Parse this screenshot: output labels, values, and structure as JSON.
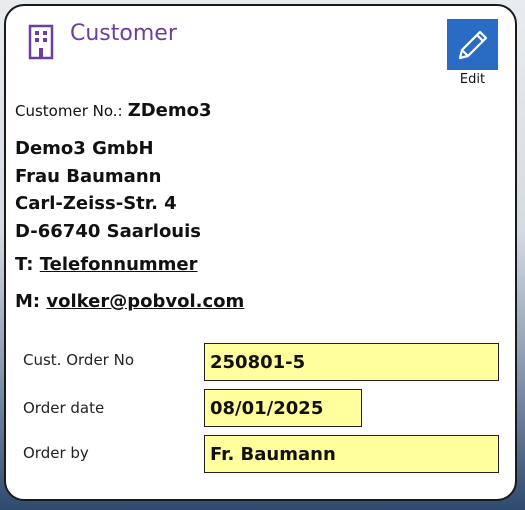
{
  "header": {
    "title": "Customer",
    "icon": "building-icon",
    "edit_label": "Edit",
    "edit_icon": "pencil-icon",
    "edit_color": "#2a6bc4"
  },
  "customer": {
    "number_label": "Customer No.:",
    "number_value": "ZDemo3",
    "address_lines": [
      "Demo3 GmbH",
      "Frau Baumann",
      "Carl-Zeiss-Str. 4",
      "D-66740 Saarlouis"
    ],
    "phone_prefix": "T:",
    "phone_link": "Telefonnummer",
    "mail_prefix": "M:",
    "mail_link": "volker@pobvol.com"
  },
  "order": {
    "cust_order_no_label": "Cust. Order No",
    "cust_order_no_value": "250801-5",
    "order_date_label": "Order date",
    "order_date_value": "08/01/2025",
    "order_by_label": "Order by",
    "order_by_value": "Fr. Baumann"
  },
  "colors": {
    "title": "#6b3fa0",
    "field_background": "#ffff9e"
  }
}
